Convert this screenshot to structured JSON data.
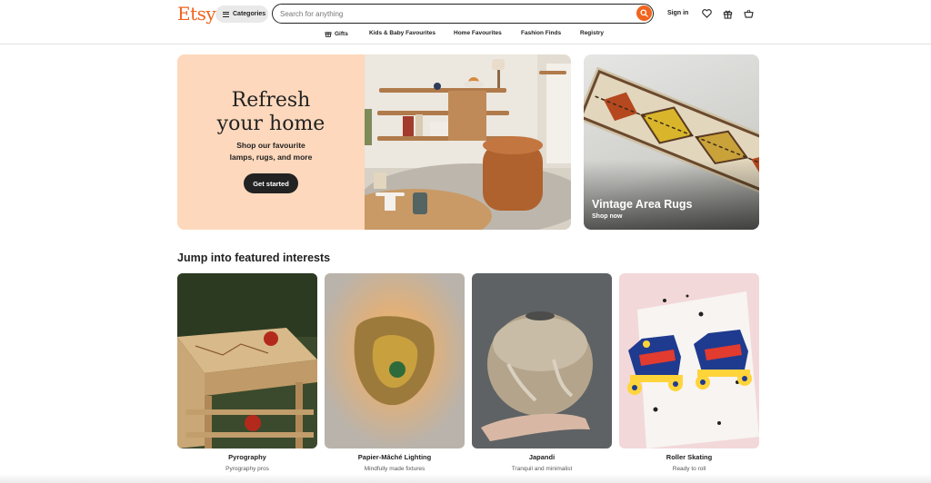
{
  "header": {
    "logo": "Etsy",
    "categories_label": "Categories",
    "search_placeholder": "Search for anything",
    "sign_in": "Sign in"
  },
  "nav": {
    "items": [
      {
        "label": "Gifts",
        "icon": "gift-icon"
      },
      {
        "label": "Kids & Baby Favourites"
      },
      {
        "label": "Home Favourites"
      },
      {
        "label": "Fashion Finds"
      },
      {
        "label": "Registry"
      }
    ]
  },
  "hero": {
    "title_line1": "Refresh",
    "title_line2": "your home",
    "subtitle_line1": "Shop our favourite",
    "subtitle_line2": "lamps, rugs, and more",
    "button": "Get started"
  },
  "promo": {
    "title": "Vintage Area Rugs",
    "link": "Shop now"
  },
  "featured": {
    "heading": "Jump into featured interests",
    "cards": [
      {
        "title": "Pyrography",
        "subtitle": "Pyrography pros"
      },
      {
        "title": "Papier-Mâché Lighting",
        "subtitle": "Mindfully made fixtures"
      },
      {
        "title": "Japandi",
        "subtitle": "Tranquil and minimalist"
      },
      {
        "title": "Roller Skating",
        "subtitle": "Ready to roll"
      }
    ]
  },
  "colors": {
    "brand": "#f1641e",
    "hero_bg": "#fdd8bc",
    "button_dark": "#222222"
  }
}
